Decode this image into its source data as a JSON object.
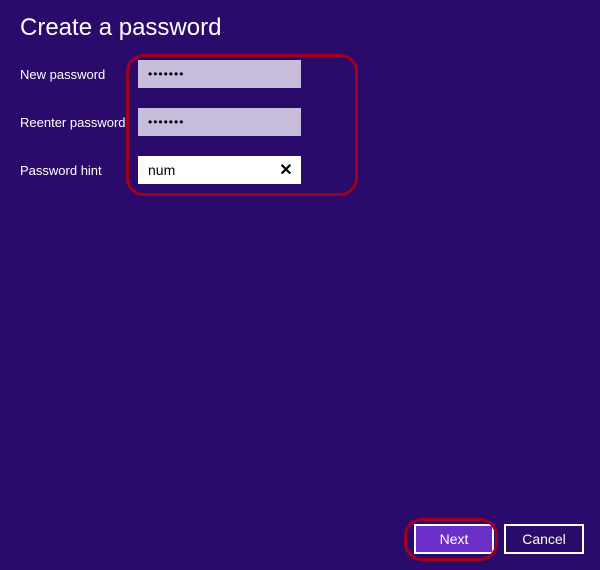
{
  "title": "Create a password",
  "labels": {
    "new_password": "New password",
    "reenter_password": "Reenter password",
    "password_hint": "Password hint"
  },
  "values": {
    "new_password": "•••••••",
    "reenter_password": "•••••••",
    "hint": "num"
  },
  "icons": {
    "clear": "✕"
  },
  "buttons": {
    "next": "Next",
    "cancel": "Cancel"
  }
}
